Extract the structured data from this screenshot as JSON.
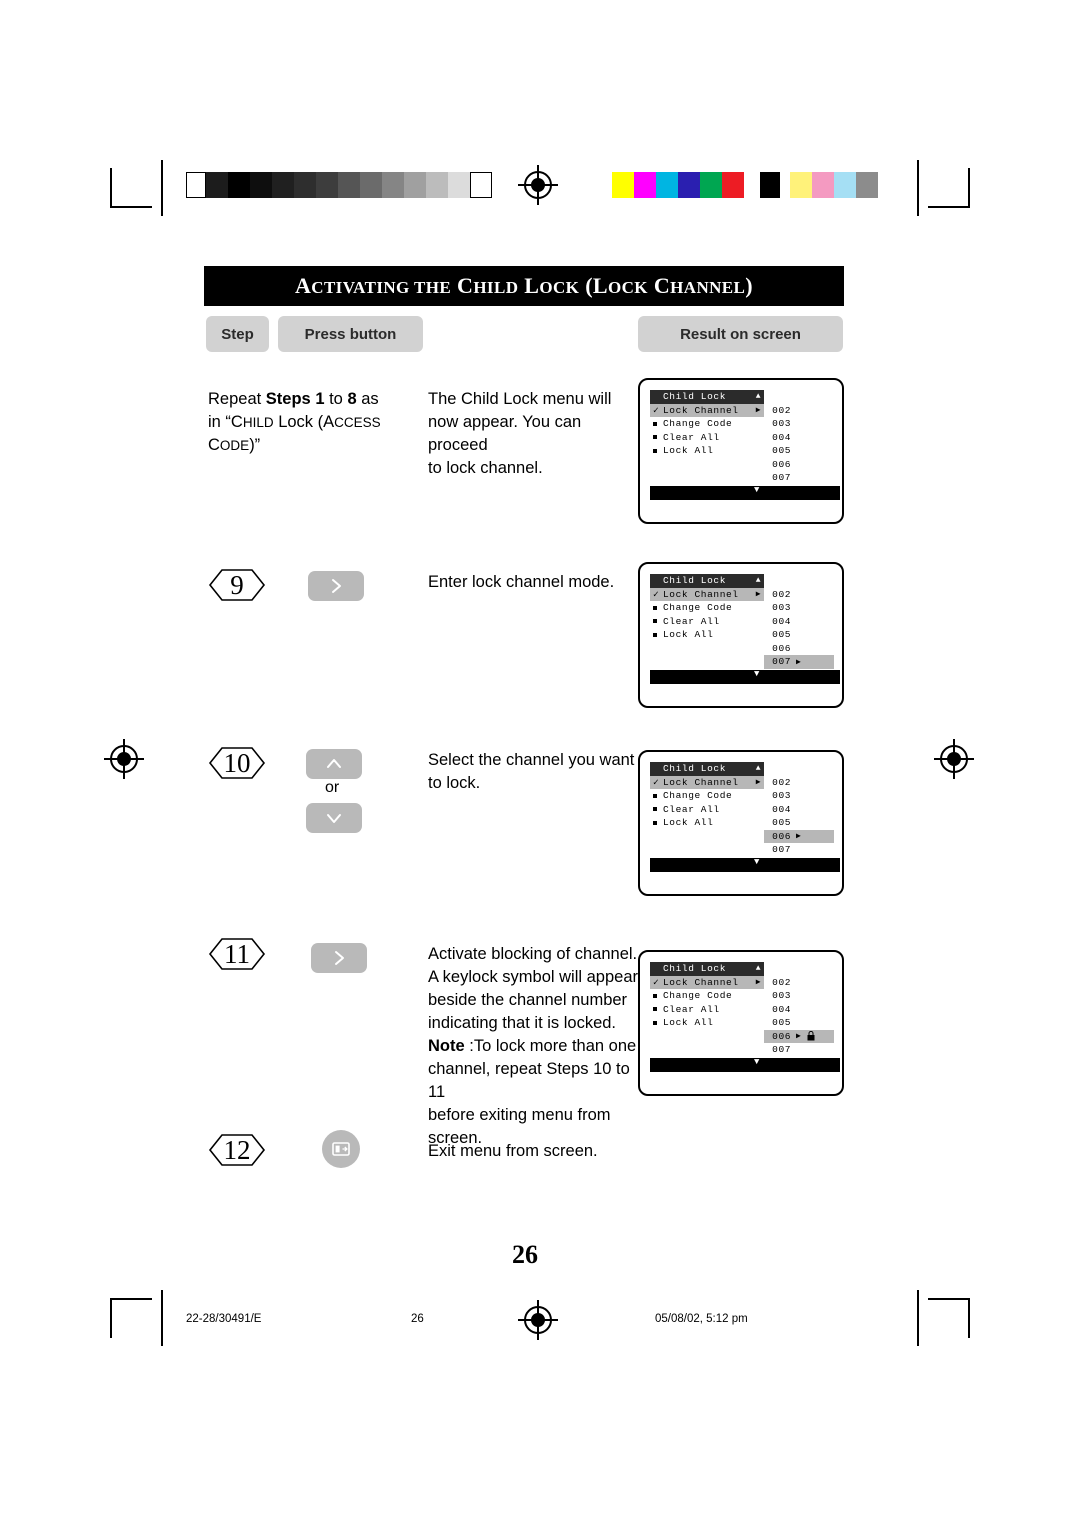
{
  "document": {
    "title_prefix": "A",
    "title": "CTIVATING THE CHILD LOCK (LOCK CHANNEL)",
    "title_full": "ACTIVATING THE CHILD LOCK (LOCK CHANNEL)",
    "page_number": "26",
    "footer_left": "22-28/30491/E",
    "footer_center": "26",
    "footer_right": "05/08/02, 5:12 pm"
  },
  "columns": {
    "step": "Step",
    "press_button": "Press button",
    "result": "Result on screen"
  },
  "rows": [
    {
      "step": "",
      "instruction_lines": [
        "Repeat Steps 1 to 8 as",
        "in “CHILD Lock (ACCESS",
        "CODE)”"
      ],
      "result_text_lines": [
        "The Child Lock menu will",
        "now appear. You can proceed",
        "to lock channel."
      ],
      "button": ""
    },
    {
      "step": "9",
      "button_icon": "chevron-right-icon",
      "result_text_lines": [
        "Enter lock channel mode."
      ]
    },
    {
      "step": "10",
      "button_icon_up": "chevron-up-icon",
      "or": "or",
      "button_icon_down": "chevron-down-icon",
      "result_text_lines": [
        "Select the channel you want",
        "to lock."
      ]
    },
    {
      "step": "11",
      "button_icon": "chevron-right-icon",
      "result_text_lines": [
        "Activate blocking of channel.",
        "A keylock symbol will appear",
        "beside the channel number",
        "indicating that it is locked.",
        "Note :To lock more than one",
        "channel, repeat Steps 10 to 11",
        "before exiting menu from",
        "screen."
      ],
      "note_label": "Note",
      "note_rest": " :To lock more than one"
    },
    {
      "step": "12",
      "button_icon": "menu-exit-icon",
      "result_text_lines": [
        "Exit menu from screen."
      ]
    }
  ],
  "osd_screens": [
    {
      "id": "osd-1",
      "title": "Child Lock",
      "title_arrow": "▲",
      "menu_items": [
        {
          "label": "Lock Channel",
          "check": true,
          "arrow": true,
          "highlight": true
        },
        {
          "label": "Change Code",
          "bullet": true
        },
        {
          "label": "Clear All",
          "bullet": true
        },
        {
          "label": "Lock All",
          "bullet": true
        }
      ],
      "channels": [
        "002",
        "003",
        "004",
        "005",
        "006",
        "007"
      ],
      "selected_channel": null,
      "selected_arrow": false,
      "lock_icon": false,
      "down_arrow": "▼"
    },
    {
      "id": "osd-2",
      "title": "Child Lock",
      "title_arrow": "▲",
      "menu_items": [
        {
          "label": "Lock Channel",
          "check": true,
          "arrow": true,
          "highlight": true
        },
        {
          "label": "Change Code",
          "bullet": true
        },
        {
          "label": "Clear All",
          "bullet": true
        },
        {
          "label": "Lock All",
          "bullet": true
        }
      ],
      "channels": [
        "002",
        "003",
        "004",
        "005",
        "006",
        "007"
      ],
      "selected_channel": "007",
      "selected_arrow": true,
      "lock_icon": false,
      "down_arrow": "▼"
    },
    {
      "id": "osd-3",
      "title": "Child Lock",
      "title_arrow": "▲",
      "menu_items": [
        {
          "label": "Lock Channel",
          "check": true,
          "arrow": true,
          "highlight": true
        },
        {
          "label": "Change Code",
          "bullet": true
        },
        {
          "label": "Clear All",
          "bullet": true
        },
        {
          "label": "Lock All",
          "bullet": true
        }
      ],
      "channels": [
        "002",
        "003",
        "004",
        "005",
        "006",
        "007"
      ],
      "selected_channel": "006",
      "selected_arrow": true,
      "lock_icon": false,
      "down_arrow": "▼"
    },
    {
      "id": "osd-4",
      "title": "Child Lock",
      "title_arrow": "▲",
      "menu_items": [
        {
          "label": "Lock Channel",
          "check": true,
          "arrow": true,
          "highlight": true
        },
        {
          "label": "Change Code",
          "bullet": true
        },
        {
          "label": "Clear All",
          "bullet": true
        },
        {
          "label": "Lock All",
          "bullet": true
        }
      ],
      "channels": [
        "002",
        "003",
        "004",
        "005",
        "006",
        "007"
      ],
      "selected_channel": "006",
      "selected_arrow": true,
      "lock_icon": true,
      "down_arrow": "▼"
    }
  ],
  "print_marks": {
    "grayscale_swatches": [
      "#ffffff",
      "#1a1a1a",
      "#000000",
      "#0d0d0d",
      "#262626",
      "#333333",
      "#4d4d4d",
      "#666666",
      "#808080",
      "#999999",
      "#b3b3b3",
      "#cccccc",
      "#e6e6e6",
      "#ffffff"
    ],
    "color_swatches": [
      "#ffff00",
      "#ff00ff",
      "#00ffff",
      "#0000c8",
      "#00a651",
      "#ed1c24",
      "#000000",
      "#fff79a",
      "#f49ac1",
      "#a5dff4",
      "#8c8c8c"
    ]
  }
}
